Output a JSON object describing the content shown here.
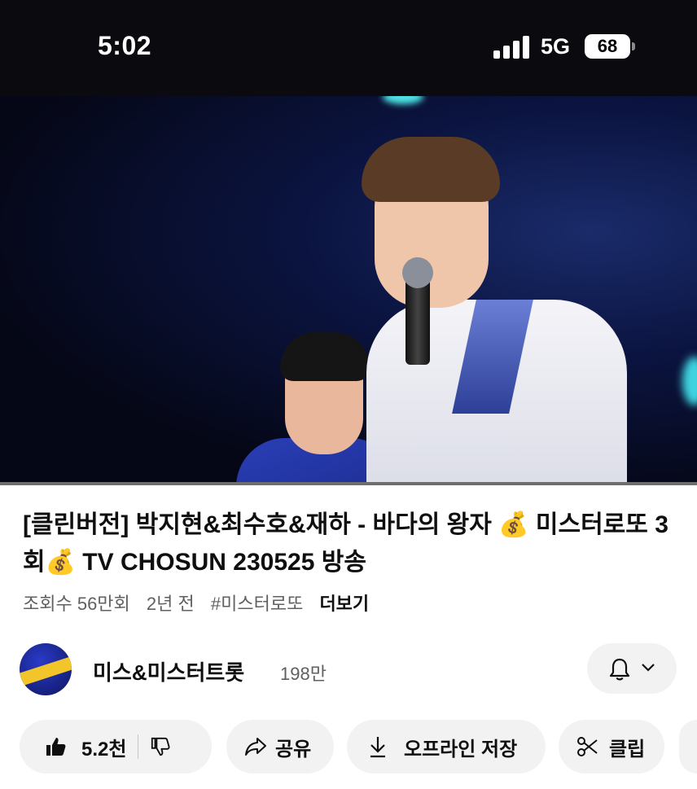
{
  "status_bar": {
    "time": "5:02",
    "network": "5G",
    "battery": "68"
  },
  "video": {
    "progress": 0.0
  },
  "title": "[클린버전] 박지현&최수호&재하 - 바다의 왕자 💰 미스터로또 3회💰 TV CHOSUN 230525 방송",
  "meta": {
    "views": "조회수 56만회",
    "age": "2년 전",
    "hashtag": "#미스터로또",
    "more": "더보기"
  },
  "channel": {
    "name": "미스&미스터트롯",
    "subscribers": "198만"
  },
  "actions": {
    "like_count": "5.2천",
    "share": "공유",
    "download": "오프라인 저장",
    "clip": "클립"
  },
  "icons": {
    "like": "thumbs-up-icon",
    "dislike": "thumbs-down-icon",
    "share": "share-arrow-icon",
    "download": "download-icon",
    "clip": "scissors-icon",
    "bell": "bell-icon"
  }
}
